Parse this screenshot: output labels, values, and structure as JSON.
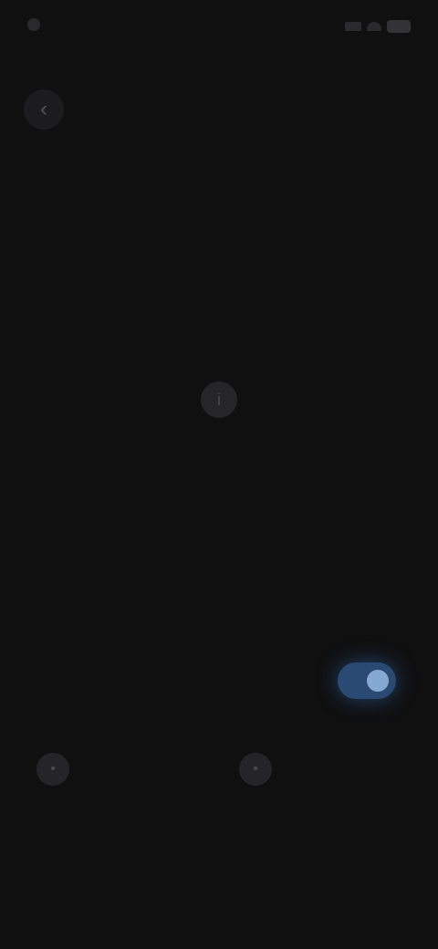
{
  "status_bar": {
    "time": "",
    "icons": [
      "signal-icon",
      "wifi-icon",
      "battery-icon"
    ]
  },
  "header": {
    "back_icon": "back-arrow-icon",
    "title": ""
  },
  "subheading": "",
  "empty_state": {
    "icon": "info-icon",
    "title": "",
    "description": ""
  },
  "toggle_row": {
    "label": "",
    "enabled": true,
    "accent_color": "#86a9d4"
  },
  "actions": [
    {
      "icon": "action-icon",
      "label": ""
    },
    {
      "icon": "action-icon",
      "label": ""
    }
  ],
  "colors": {
    "background": "#101011",
    "toggle_track": "#2b4a73"
  }
}
